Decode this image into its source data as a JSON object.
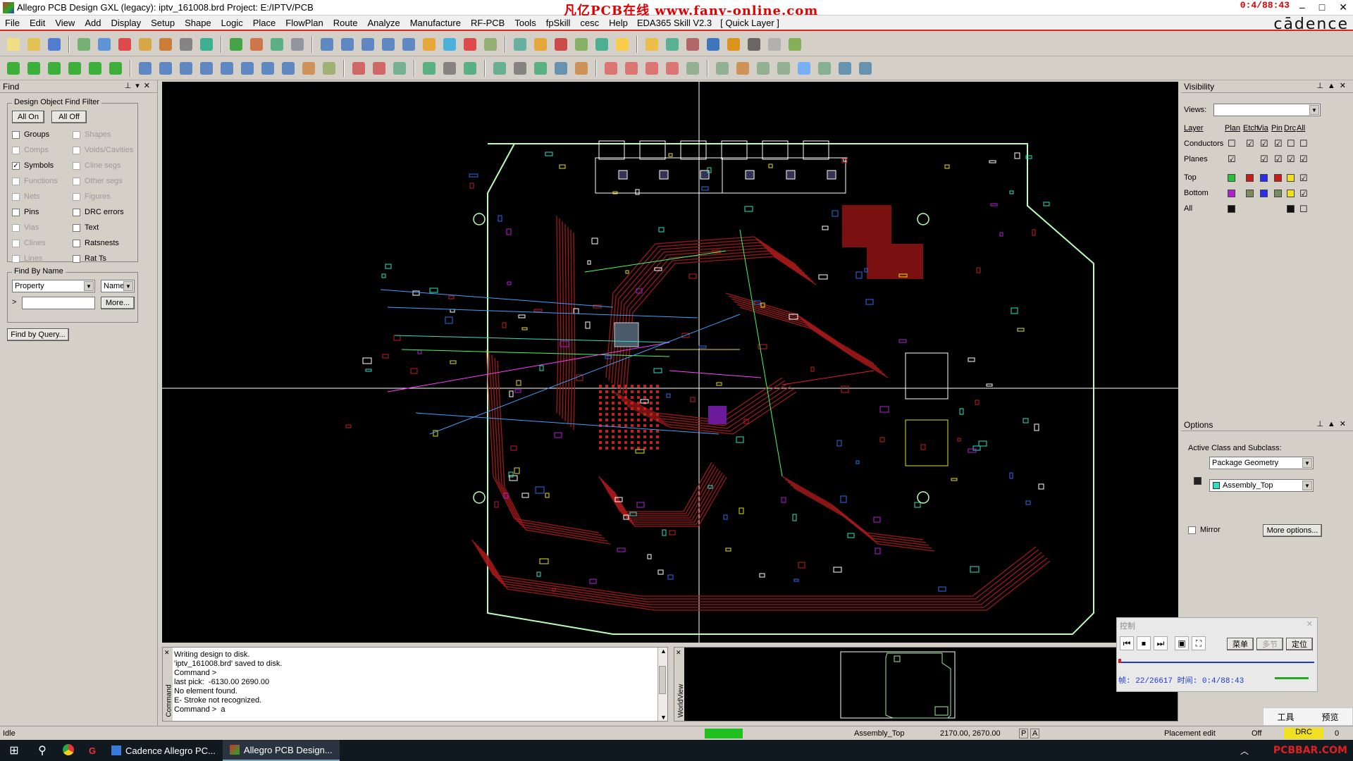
{
  "window": {
    "title": "Allegro PCB Design GXL (legacy): iptv_161008.brd  Project: E:/IPTV/PCB",
    "watermark": "凡亿PCB在线  www.fany-online.com",
    "clock": "0:4/88:43",
    "minimize": "–",
    "restore": "□",
    "close": "✕"
  },
  "brand": "cādence",
  "menu": [
    "File",
    "Edit",
    "View",
    "Add",
    "Display",
    "Setup",
    "Shape",
    "Logic",
    "Place",
    "FlowPlan",
    "Route",
    "Analyze",
    "Manufacture",
    "RF-PCB",
    "Tools",
    "fpSkill",
    "cesc",
    "Help"
  ],
  "menu_extra": [
    "EDA365 Skill V2.3",
    "[ Quick Layer ]"
  ],
  "find_panel": {
    "title": "Find",
    "filter_group": "Design Object Find Filter",
    "all_on": "All On",
    "all_off": "All Off",
    "left_items": [
      {
        "label": "Groups",
        "checked": false,
        "enabled": true
      },
      {
        "label": "Comps",
        "checked": false,
        "enabled": false
      },
      {
        "label": "Symbols",
        "checked": true,
        "enabled": true
      },
      {
        "label": "Functions",
        "checked": false,
        "enabled": false
      },
      {
        "label": "Nets",
        "checked": false,
        "enabled": false
      },
      {
        "label": "Pins",
        "checked": false,
        "enabled": true
      },
      {
        "label": "Vias",
        "checked": false,
        "enabled": false
      },
      {
        "label": "Clines",
        "checked": false,
        "enabled": false
      },
      {
        "label": "Lines",
        "checked": false,
        "enabled": false
      }
    ],
    "right_items": [
      {
        "label": "Shapes",
        "checked": false,
        "enabled": false
      },
      {
        "label": "Voids/Cavities",
        "checked": false,
        "enabled": false
      },
      {
        "label": "Cline segs",
        "checked": false,
        "enabled": false
      },
      {
        "label": "Other segs",
        "checked": false,
        "enabled": false
      },
      {
        "label": "Figures",
        "checked": false,
        "enabled": false
      },
      {
        "label": "DRC errors",
        "checked": false,
        "enabled": true
      },
      {
        "label": "Text",
        "checked": false,
        "enabled": true
      },
      {
        "label": "Ratsnests",
        "checked": false,
        "enabled": true
      },
      {
        "label": "Rat Ts",
        "checked": false,
        "enabled": true
      }
    ],
    "by_name_group": "Find By Name",
    "property_select": "Property",
    "name_select": "Name",
    "prompt": ">",
    "name_input": "",
    "more": "More...",
    "query": "Find by Query..."
  },
  "visibility": {
    "title": "Visibility",
    "views_label": "Views:",
    "views_value": "",
    "headers": [
      "Layer",
      "Plan",
      "Etch",
      "Via",
      "Pin",
      "Drc",
      "All"
    ],
    "rows": [
      {
        "name": "Conductors",
        "cells": [
          "☐",
          "☑",
          "☑",
          "☑",
          "☐",
          "☐"
        ]
      },
      {
        "name": "Planes",
        "cells": [
          "☑",
          "",
          "☑",
          "☑",
          "☑",
          "☑"
        ]
      }
    ],
    "layers": [
      {
        "name": "Top",
        "colors": [
          "#27c23a",
          "#c81c1c",
          "#2b2bea",
          "#c81c1c",
          "#f0e020"
        ],
        "all": "☑"
      },
      {
        "name": "Bottom",
        "colors": [
          "#b020d0",
          "#7a8a5a",
          "#2b2bea",
          "#7a8a5a",
          "#f0e020"
        ],
        "all": "☑"
      },
      {
        "name": "All",
        "colors": [
          "#111111",
          "",
          "",
          "",
          "#111111"
        ],
        "all": "☐"
      }
    ]
  },
  "options": {
    "title": "Options",
    "active_label": "Active Class and Subclass:",
    "class_value": "Package Geometry",
    "subclass_value": "Assembly_Top",
    "subclass_color": "#2fe0c0",
    "mirror": "Mirror",
    "more_options": "More options..."
  },
  "command": {
    "side_label": "Command",
    "lines": [
      "Writing design to disk.",
      "'iptv_161008.brd' saved to disk.",
      "Command >",
      "last pick:  -6130.00 2690.00",
      "No element found.",
      "E- Stroke not recognized.",
      "Command >  a"
    ]
  },
  "worldview": {
    "side_label": "WorldView"
  },
  "control_panel": {
    "title": "控制",
    "menu_btn": "菜单",
    "multi_btn": "多节",
    "locate_btn": "定位",
    "frame_info": "帧: 22/26617  时间: 0:4/88:43",
    "progress_fraction": 0.014,
    "tools": "工具",
    "preview": "预览"
  },
  "statusbar": {
    "state": "Idle",
    "subclass": "Assembly_Top",
    "coords": "2170.00, 2670.00",
    "p_flag": "P",
    "a_flag": "A",
    "mode": "Placement edit",
    "off": "Off",
    "drc": "DRC",
    "count": "0"
  },
  "taskbar": {
    "items": [
      {
        "label": "Cadence Allegro PC...",
        "active": false
      },
      {
        "label": "Allegro PCB Design...",
        "active": true
      }
    ],
    "tray_text": "PCBBAR.COM"
  },
  "colors": {
    "trace": "#a01818",
    "trace_bright": "#e02020",
    "outline": "#b8ffb8",
    "assembly": "#ffffff",
    "rats": "#40a0ff"
  }
}
